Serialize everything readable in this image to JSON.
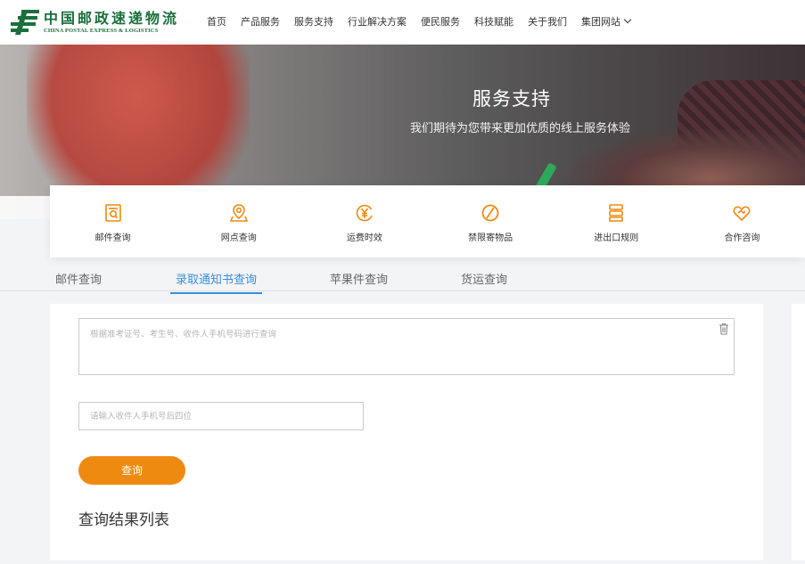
{
  "header": {
    "logo_cn": "中国邮政速递物流",
    "logo_en": "CHINA POSTAL EXPRESS & LOGISTICS",
    "nav": [
      {
        "label": "首页"
      },
      {
        "label": "产品服务"
      },
      {
        "label": "服务支持"
      },
      {
        "label": "行业解决方案"
      },
      {
        "label": "便民服务"
      },
      {
        "label": "科技赋能"
      },
      {
        "label": "关于我们"
      },
      {
        "label": "集团网站"
      }
    ]
  },
  "banner": {
    "title": "服务支持",
    "subtitle": "我们期待为您带来更加优质的线上服务体验"
  },
  "services": [
    {
      "label": "邮件查询",
      "icon": "mail-search-icon"
    },
    {
      "label": "网点查询",
      "icon": "location-pin-icon"
    },
    {
      "label": "运费时效",
      "icon": "yen-clock-icon"
    },
    {
      "label": "禁限寄物品",
      "icon": "prohibited-icon"
    },
    {
      "label": "进出口规则",
      "icon": "rules-icon"
    },
    {
      "label": "合作咨询",
      "icon": "handshake-heart-icon"
    }
  ],
  "tabs": [
    {
      "label": "邮件查询",
      "active": false
    },
    {
      "label": "录取通知书查询",
      "active": true
    },
    {
      "label": "苹果件查询",
      "active": false
    },
    {
      "label": "货运查询",
      "active": false
    }
  ],
  "form": {
    "textarea_placeholder": "根据准考证号、考生号、收件人手机号码进行查询",
    "textarea_value": "",
    "phone_placeholder": "请输入收件人手机号后四位",
    "phone_value": "",
    "query_button": "查询",
    "result_title": "查询结果列表"
  },
  "colors": {
    "accent_orange": "#ef8a11",
    "tab_active_blue": "#3c8ddc",
    "brand_green": "#1a6f3c"
  }
}
